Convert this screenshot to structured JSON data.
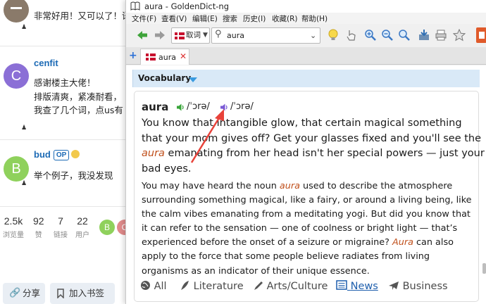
{
  "forum": {
    "post1": {
      "avatar_letter": "",
      "line": "非常好用！又可以了！语"
    },
    "post2": {
      "avatar_letter": "C",
      "username": "cenfit",
      "line1": "感谢楼主大佬！",
      "line2": "排版清爽，紧凑耐看，",
      "line3": "我查了几个词，点us有"
    },
    "post3": {
      "avatar_letter": "B",
      "username": "bud",
      "flair": "OP",
      "line": "举个例子，我没发现"
    },
    "stats": [
      {
        "value": "2.5k",
        "label": "浏览量"
      },
      {
        "value": "92",
        "label": "赞"
      },
      {
        "value": "7",
        "label": "链接"
      },
      {
        "value": "22",
        "label": "用户"
      }
    ],
    "participants": [
      "B",
      "C"
    ],
    "share_label": "分享",
    "bookmark_label": "加入书签",
    "colors": {
      "avatar_gray": "#8a7a6a",
      "avatar_purple": "#8b6fd6",
      "avatar_green": "#8fd15c",
      "link_blue": "#1c6ab5"
    }
  },
  "window": {
    "title": "aura - GoldenDict-ng",
    "menu": [
      "文件(F)",
      "查看(V)",
      "编辑(E)",
      "搜索",
      "历史(I)",
      "收藏(R)",
      "帮助(H)"
    ],
    "group_label": "取词",
    "search_value": "aura",
    "tab_label": "aura"
  },
  "article": {
    "dictionary": "Vocabulary",
    "headword": "aura",
    "pron_uk": "/ˈɔrə/",
    "pron_us": "/ˈɔrə/",
    "lead_lines": [
      [
        "You know that intangible glow, that certain magical something"
      ],
      [
        "that your mom gives off? Get your glasses fixed and you'll see the"
      ],
      [
        "",
        "aura",
        " emanating from her head isn't her special powers — just your"
      ],
      [
        "bad eyes."
      ]
    ],
    "body_lines": [
      [
        "You may have heard the noun ",
        "aura",
        " used to describe the atmosphere"
      ],
      [
        "surrounding something magical, like a fairy, or around a living being, like"
      ],
      [
        "the calm vibes emanating from a meditating yogi. But did you know that"
      ],
      [
        "it can refer to the sensation — one of coolness or bright light — that’s"
      ],
      [
        "experienced before the onset of a seizure or migraine? ",
        "Aura",
        " can also"
      ],
      [
        "apply to the force that some people believe radiates from living"
      ],
      [
        "organisms as an indicator of their unique essence."
      ]
    ],
    "categories": [
      {
        "label": "All",
        "icon": "globe-icon"
      },
      {
        "label": "Literature",
        "icon": "quill-icon"
      },
      {
        "label": "Arts/Culture",
        "icon": "palette-icon"
      },
      {
        "label": "News",
        "icon": "newspaper-icon",
        "active": true
      },
      {
        "label": "Business",
        "icon": "plane-icon"
      }
    ],
    "colors": {
      "highlight": "#c0501c",
      "header_bg": "#d9e9f7",
      "active_link": "#1f5fad",
      "arrow": "#e8423a"
    }
  }
}
